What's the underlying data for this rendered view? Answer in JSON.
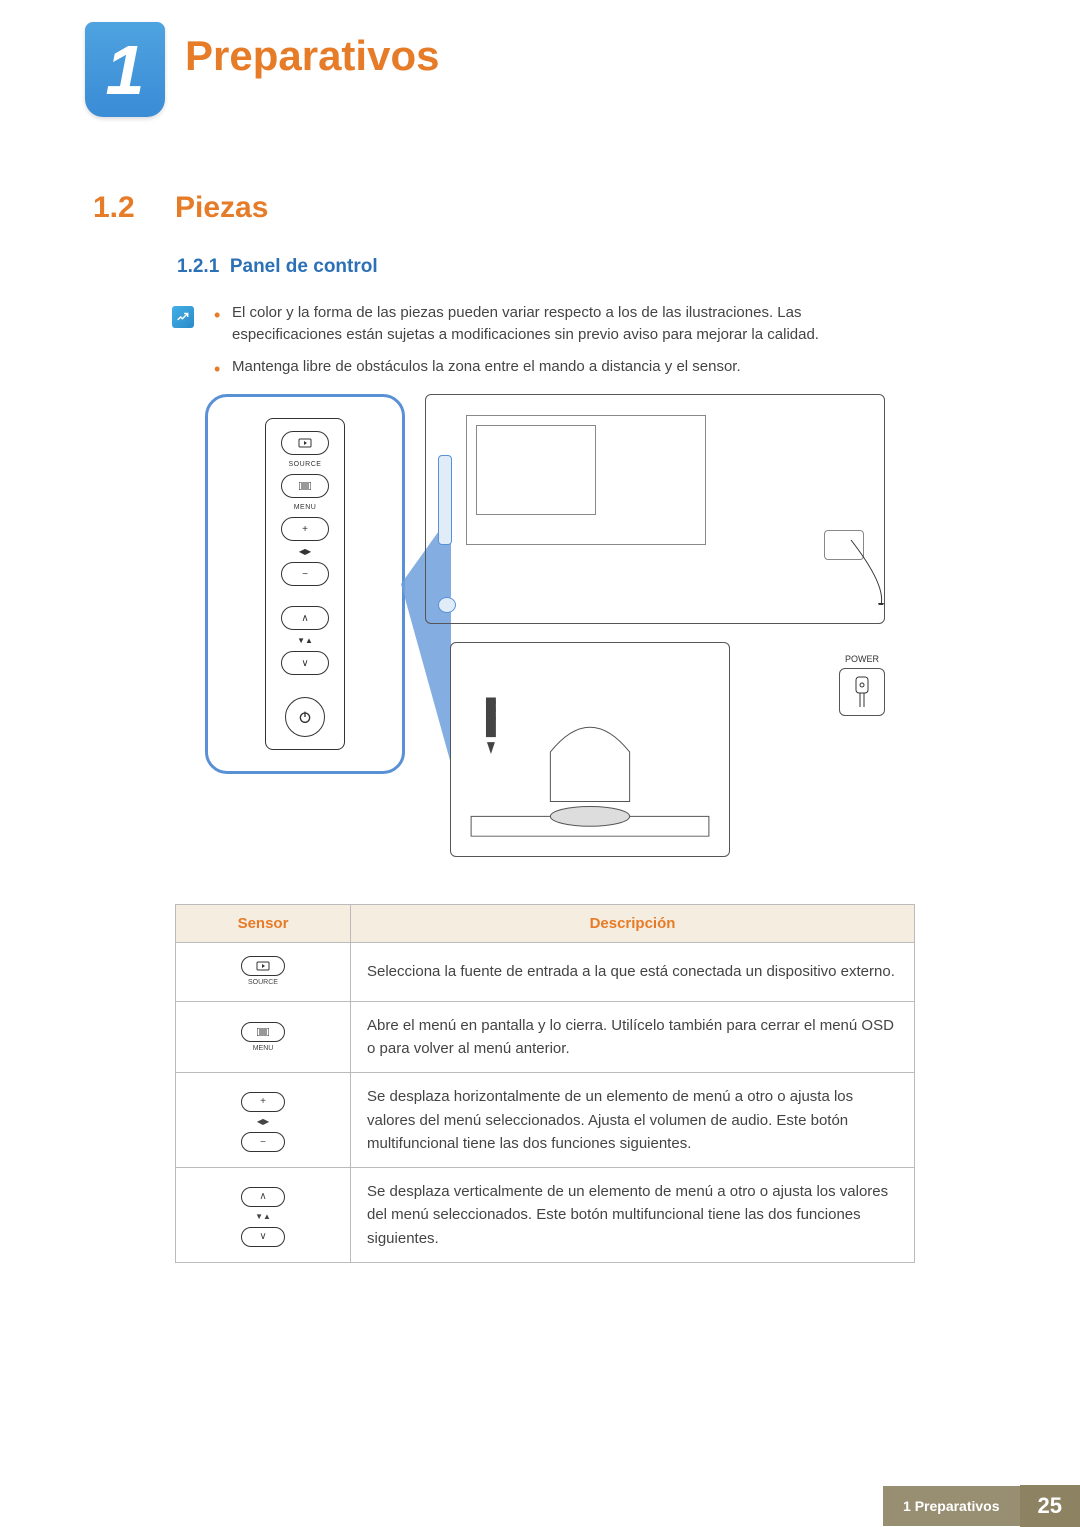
{
  "chapter": {
    "number": "1",
    "title": "Preparativos"
  },
  "section": {
    "number": "1.2",
    "title": "Piezas"
  },
  "subsection": {
    "number": "1.2.1",
    "title": "Panel de control"
  },
  "notes": [
    "El color y la forma de las piezas pueden variar respecto a los de las ilustraciones. Las especificaciones están sujetas a modificaciones sin previo aviso para mejorar la calidad.",
    "Mantenga libre de obstáculos la zona entre el mando a distancia y el sensor."
  ],
  "panel_labels": {
    "source": "SOURCE",
    "menu": "MENU",
    "power_label": "POWER"
  },
  "table": {
    "headers": {
      "sensor": "Sensor",
      "desc": "Descripción"
    },
    "rows": [
      {
        "icon": "source",
        "desc": "Selecciona la fuente de entrada a la que está conectada un dispositivo externo."
      },
      {
        "icon": "menu",
        "desc": "Abre el menú en pantalla y lo cierra. Utilícelo también para cerrar el menú OSD o para volver al menú anterior."
      },
      {
        "icon": "plusminus",
        "desc": "Se desplaza horizontalmente de un elemento de menú a otro o ajusta los valores del menú seleccionados. Ajusta el volumen de audio. Este botón multifuncional tiene las dos funciones siguientes."
      },
      {
        "icon": "updown",
        "desc": "Se desplaza verticalmente de un elemento de menú a otro o ajusta los valores del menú seleccionados. Este botón multifuncional tiene las dos funciones siguientes."
      }
    ]
  },
  "footer": {
    "crumb": "1 Preparativos",
    "page": "25"
  }
}
